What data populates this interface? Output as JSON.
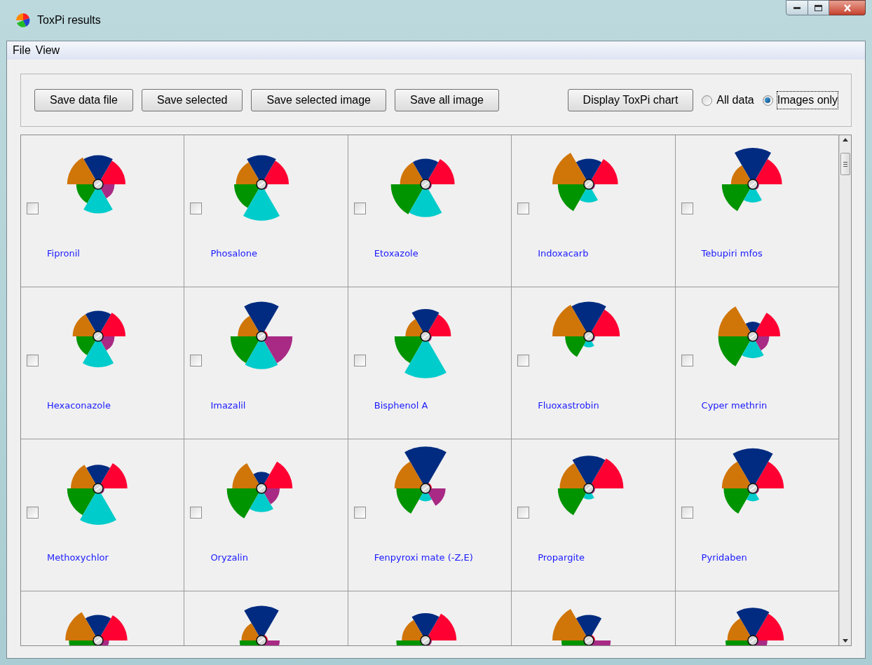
{
  "window": {
    "title": "ToxPi results"
  },
  "menu": [
    "File",
    "View"
  ],
  "toolbar": {
    "buttons": [
      "Save data file",
      "Save selected",
      "Save selected image",
      "Save all image",
      "Display ToxPi chart"
    ],
    "radios": [
      {
        "label": "All data",
        "selected": false
      },
      {
        "label": "Images only",
        "selected": true
      }
    ]
  },
  "results": [
    {
      "name": "Fipronil",
      "checked": false
    },
    {
      "name": "Phosalone",
      "checked": false
    },
    {
      "name": "Etoxazole",
      "checked": false
    },
    {
      "name": "Indoxacarb",
      "checked": false
    },
    {
      "name": "Tebupiri mfos",
      "checked": false
    },
    {
      "name": "Hexaconazole",
      "checked": false
    },
    {
      "name": "Imazalil",
      "checked": false
    },
    {
      "name": "Bisphenol A",
      "checked": false
    },
    {
      "name": "Fluoxastrobin",
      "checked": false
    },
    {
      "name": "Cyper methrin",
      "checked": false
    },
    {
      "name": "Methoxychlor",
      "checked": false
    },
    {
      "name": "Oryzalin",
      "checked": false
    },
    {
      "name": "Fenpyroxi mate (-Z,E)",
      "checked": false
    },
    {
      "name": "Propargite",
      "checked": false
    },
    {
      "name": "Pyridaben",
      "checked": false
    }
  ]
}
